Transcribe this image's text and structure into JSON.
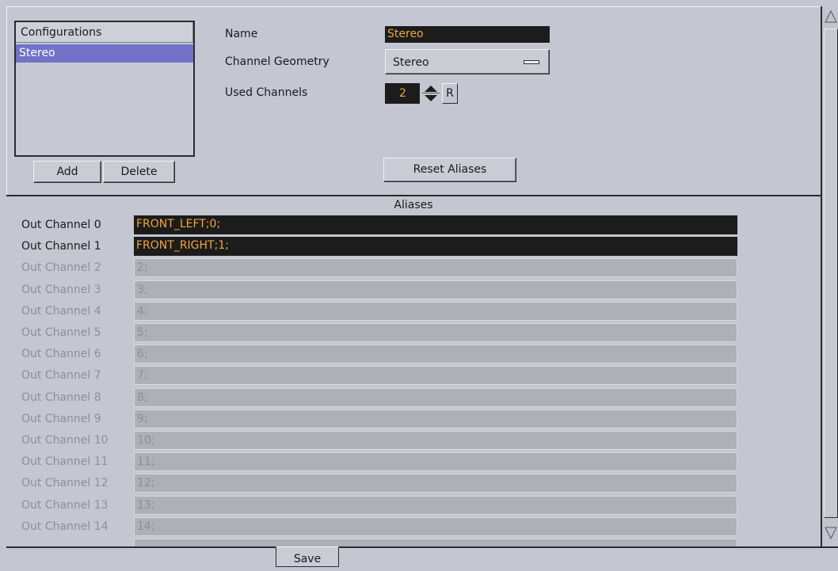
{
  "configurations": {
    "header": "Configurations",
    "items": [
      "Stereo"
    ]
  },
  "buttons": {
    "add": "Add",
    "delete": "Delete",
    "reset_aliases": "Reset Aliases",
    "save": "Save",
    "reset_r": "R"
  },
  "properties": {
    "name_label": "Name",
    "name_value": "Stereo",
    "geometry_label": "Channel Geometry",
    "geometry_value": "Stereo",
    "used_channels_label": "Used Channels",
    "used_channels_value": "2"
  },
  "aliases": {
    "title": "Aliases",
    "rows": [
      {
        "label": "Out Channel 0",
        "value": "FRONT_LEFT;0;",
        "active": true
      },
      {
        "label": "Out Channel 1",
        "value": "FRONT_RIGHT;1;",
        "active": true
      },
      {
        "label": "Out Channel 2",
        "value": "2;",
        "active": false
      },
      {
        "label": "Out Channel 3",
        "value": "3;",
        "active": false
      },
      {
        "label": "Out Channel 4",
        "value": "4;",
        "active": false
      },
      {
        "label": "Out Channel 5",
        "value": "5;",
        "active": false
      },
      {
        "label": "Out Channel 6",
        "value": "6;",
        "active": false
      },
      {
        "label": "Out Channel 7",
        "value": "7;",
        "active": false
      },
      {
        "label": "Out Channel 8",
        "value": "8;",
        "active": false
      },
      {
        "label": "Out Channel 9",
        "value": "9;",
        "active": false
      },
      {
        "label": "Out Channel 10",
        "value": "10;",
        "active": false
      },
      {
        "label": "Out Channel 11",
        "value": "11;",
        "active": false
      },
      {
        "label": "Out Channel 12",
        "value": "12;",
        "active": false
      },
      {
        "label": "Out Channel 13",
        "value": "13;",
        "active": false
      },
      {
        "label": "Out Channel 14",
        "value": "14;",
        "active": false
      }
    ]
  },
  "colors": {
    "field_text_active": "#f0a63a",
    "selection": "#7272c8",
    "background": "#c4c7d1"
  }
}
